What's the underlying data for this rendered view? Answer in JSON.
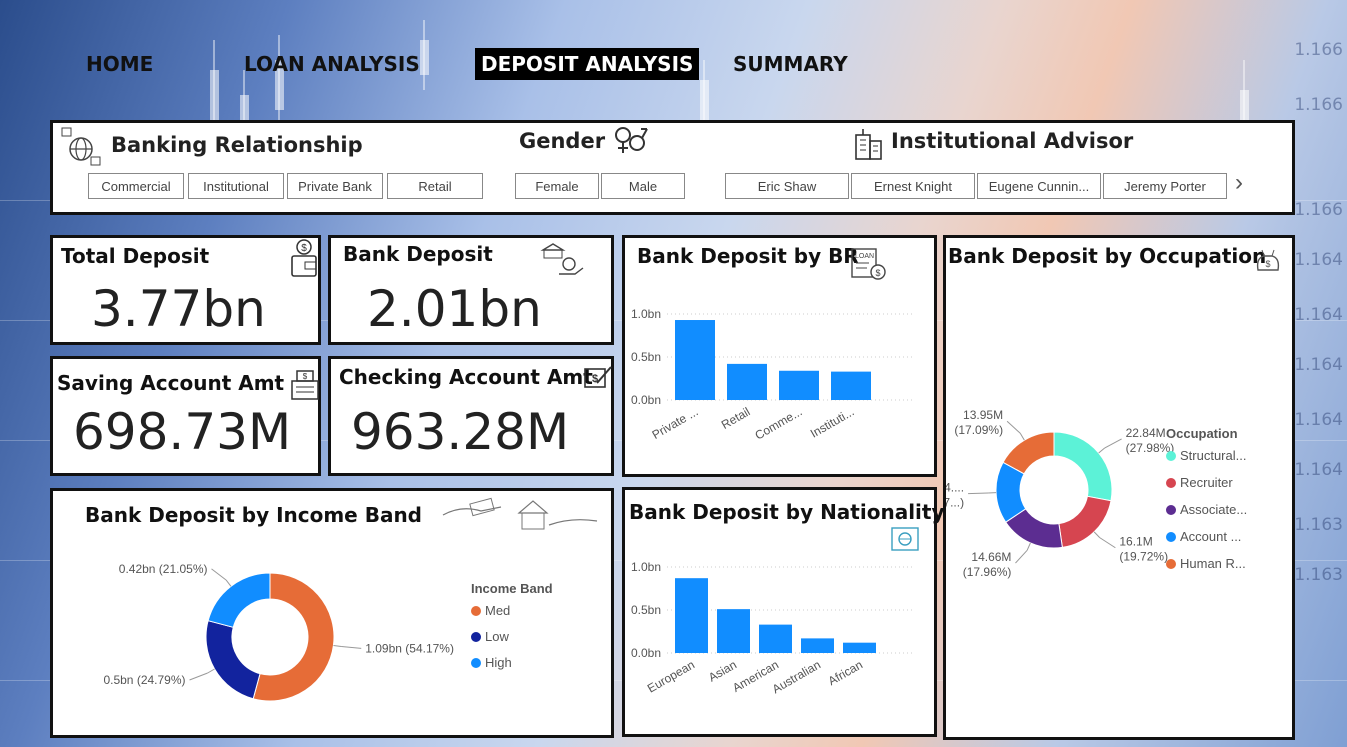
{
  "nav": {
    "home": "HOME",
    "loan": "LOAN ANALYSIS",
    "deposit": "DEPOSIT ANALYSIS",
    "summary": "SUMMARY"
  },
  "background_ticks": [
    "1.166",
    "1.166",
    "1.166",
    "1.164",
    "1.164",
    "1.164",
    "1.164",
    "1.164",
    "1.163",
    "1.163"
  ],
  "slicers": {
    "banking_relationship": {
      "title": "Banking Relationship",
      "options": [
        "Commercial",
        "Institutional",
        "Private Bank",
        "Retail"
      ]
    },
    "gender": {
      "title": "Gender",
      "options": [
        "Female",
        "Male"
      ]
    },
    "advisor": {
      "title": "Institutional Advisor",
      "options": [
        "Eric Shaw",
        "Ernest Knight",
        "Eugene Cunnin...",
        "Jeremy Porter"
      ],
      "next": "›"
    }
  },
  "cards": {
    "total_deposit": {
      "title": "Total Deposit",
      "value": "3.77bn"
    },
    "bank_deposit": {
      "title": "Bank Deposit",
      "value": "2.01bn"
    },
    "saving": {
      "title": "Saving Account Amt",
      "value": "698.73M"
    },
    "checking": {
      "title": "Checking Account Amt",
      "value": "963.28M"
    }
  },
  "chart_data": [
    {
      "type": "bar",
      "title": "Bank Deposit by BR",
      "categories": [
        "Private ...",
        "Retail",
        "Comme...",
        "Instituti..."
      ],
      "values": [
        0.93,
        0.42,
        0.34,
        0.33
      ],
      "yticks": [
        "1.0bn",
        "0.5bn",
        "0.0bn"
      ],
      "ylim": [
        0,
        1.0
      ],
      "color": "#118DFF"
    },
    {
      "type": "bar",
      "title": "Bank Deposit by Nationality",
      "categories": [
        "European",
        "Asian",
        "American",
        "Australian",
        "African"
      ],
      "values": [
        0.87,
        0.51,
        0.33,
        0.17,
        0.12
      ],
      "yticks": [
        "1.0bn",
        "0.5bn",
        "0.0bn"
      ],
      "ylim": [
        0,
        1.0
      ],
      "color": "#118DFF"
    },
    {
      "type": "pie",
      "title": "Bank Deposit by Income Band",
      "legend_title": "Income Band",
      "slices": [
        {
          "name": "Med",
          "value": 1.09,
          "pct": 54.17,
          "label": "1.09bn (54.17%)",
          "color": "#E66C37"
        },
        {
          "name": "Low",
          "value": 0.5,
          "pct": 24.79,
          "label": "0.5bn (24.79%)",
          "color": "#12239E"
        },
        {
          "name": "High",
          "value": 0.42,
          "pct": 21.05,
          "label": "0.42bn (21.05%)",
          "color": "#118DFF"
        }
      ]
    },
    {
      "type": "pie",
      "title": "Bank Deposit by Occupation",
      "legend_title": "Occupation",
      "slices": [
        {
          "name": "Structural...",
          "value": 22.84,
          "pct": 27.98,
          "label1": "22.84M",
          "label2": "(27.98%)",
          "color": "#5CF2D7"
        },
        {
          "name": "Recruiter",
          "value": 16.1,
          "pct": 19.72,
          "label1": "16.1M",
          "label2": "(19.72%)",
          "color": "#D64550"
        },
        {
          "name": "Associate...",
          "value": 14.66,
          "pct": 17.96,
          "label1": "14.66M",
          "label2": "(17.96%)",
          "color": "#5C2D91"
        },
        {
          "name": "Account ...",
          "value": 14.1,
          "pct": 17.27,
          "label1": "14....",
          "label2": "(17...)",
          "color": "#118DFF"
        },
        {
          "name": "Human R...",
          "value": 13.95,
          "pct": 17.09,
          "label1": "13.95M",
          "label2": "(17.09%)",
          "color": "#E66C37"
        }
      ]
    }
  ]
}
